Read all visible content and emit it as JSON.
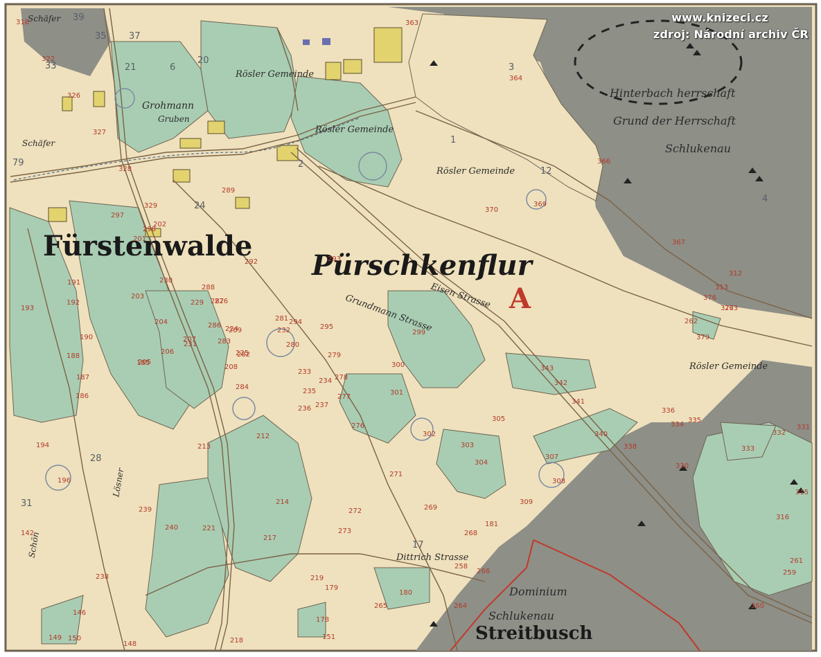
{
  "watermark": {
    "site": "www.knizeci.cz",
    "source": "zdroj: Národní archiv ČR"
  },
  "map": {
    "town": "Fürstenwalde",
    "district": "Pürschkenflur",
    "sheet_letter": "A",
    "forest": "Streitbusch",
    "estate_1": "Dominium",
    "estate_2": "Schlukenau",
    "herrschaft_lines": [
      "Hinterbach herrschaft",
      "Grund der Herrschaft",
      "Schlukenau"
    ],
    "road_1": "Grundmann Strasse",
    "road_2": "Eisen Strasse",
    "road_3": "Dittrich Strasse",
    "owner_labels": [
      "Rösler Gemeinde",
      "Rösler Gemeinde",
      "Rösler Gemeinde",
      "Rösler Gemeinde",
      "Grohmann",
      "Gruben",
      "Schäfer",
      "Schäfer",
      "Lösner",
      "Schön"
    ],
    "parcel_numbers": [
      "363",
      "364",
      "366",
      "367",
      "369",
      "370",
      "376",
      "377",
      "379",
      "330",
      "331",
      "332",
      "333",
      "334",
      "335",
      "336",
      "338",
      "340",
      "341",
      "342",
      "343",
      "299",
      "300",
      "301",
      "302",
      "303",
      "304",
      "305",
      "307",
      "308",
      "309",
      "264",
      "265",
      "266",
      "268",
      "269",
      "271",
      "272",
      "273",
      "276",
      "277",
      "278",
      "279",
      "280",
      "281",
      "282",
      "283",
      "284",
      "286",
      "287",
      "288",
      "289",
      "292",
      "293",
      "294",
      "295",
      "297",
      "298",
      "201",
      "202",
      "203",
      "204",
      "205",
      "206",
      "207",
      "208",
      "209",
      "212",
      "213",
      "214",
      "217",
      "218",
      "219",
      "221",
      "224",
      "225",
      "226",
      "229",
      "230",
      "231",
      "232",
      "233",
      "234",
      "235",
      "236",
      "237",
      "238",
      "239",
      "240",
      "185",
      "186",
      "187",
      "188",
      "190",
      "191",
      "192",
      "193",
      "194",
      "196",
      "142",
      "146",
      "148",
      "149",
      "150",
      "151",
      "178",
      "179",
      "180",
      "181",
      "258",
      "259",
      "260",
      "261",
      "262",
      "263",
      "312",
      "313",
      "315",
      "316",
      "318",
      "322",
      "326",
      "327",
      "328",
      "329"
    ],
    "grey_numbers": [
      "1",
      "2",
      "3",
      "4",
      "6",
      "12",
      "17",
      "20",
      "21",
      "24",
      "28",
      "31",
      "33",
      "35",
      "37",
      "39",
      "79"
    ]
  }
}
